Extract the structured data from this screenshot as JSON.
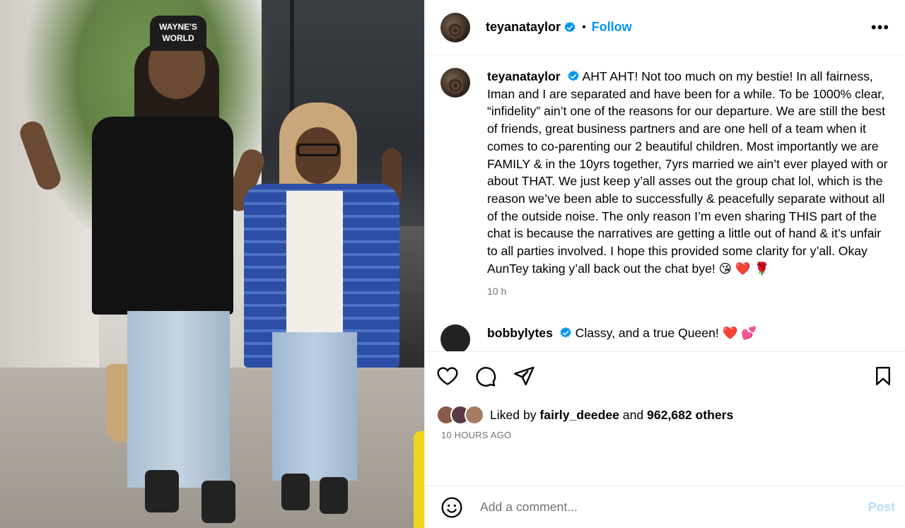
{
  "post": {
    "username": "teyanataylor",
    "follow_label": "Follow",
    "separator": "•",
    "more_icon": "more-options-icon",
    "photo_hat_text": "WAYNE'S WORLD"
  },
  "caption": {
    "username": "teyanataylor",
    "text": "AHT AHT! Not too much on my bestie! In all fairness, Iman and I are separated and have been for a while. To be 1000% clear, “infidelity” ain’t one of the reasons for our departure. We are still the best of friends, great business partners and are one hell of a team when it comes to co-parenting our 2 beautiful children. Most importantly we are FAMILY & in the 10yrs together, 7yrs married we ain’t ever played with or about THAT. We just keep y’all asses out the group chat lol, which is the reason we’ve been able to successfully & peacefully separate without all of the outside noise. The only reason I’m even sharing THIS part of the chat is because the narratives are getting a little out of hand & it’s unfair to all parties involved. I hope this provided some clarity for y’all. Okay AunTey taking y’all back out the chat bye! 😘 ❤️ 🌹",
    "time": "10 h"
  },
  "reply": {
    "username": "bobbylytes",
    "text": "Classy, and a true Queen! ❤️ 💕"
  },
  "likes": {
    "prefix": "Liked by",
    "user": "fairly_deedee",
    "and": "and",
    "count": "962,682 others"
  },
  "posted_ago": "10 HOURS AGO",
  "add_comment": {
    "placeholder": "Add a comment...",
    "post_label": "Post"
  },
  "colors": {
    "link": "#0095f6",
    "muted": "#737373",
    "post_disabled": "#b3dbff",
    "verified": "#0095f6"
  }
}
